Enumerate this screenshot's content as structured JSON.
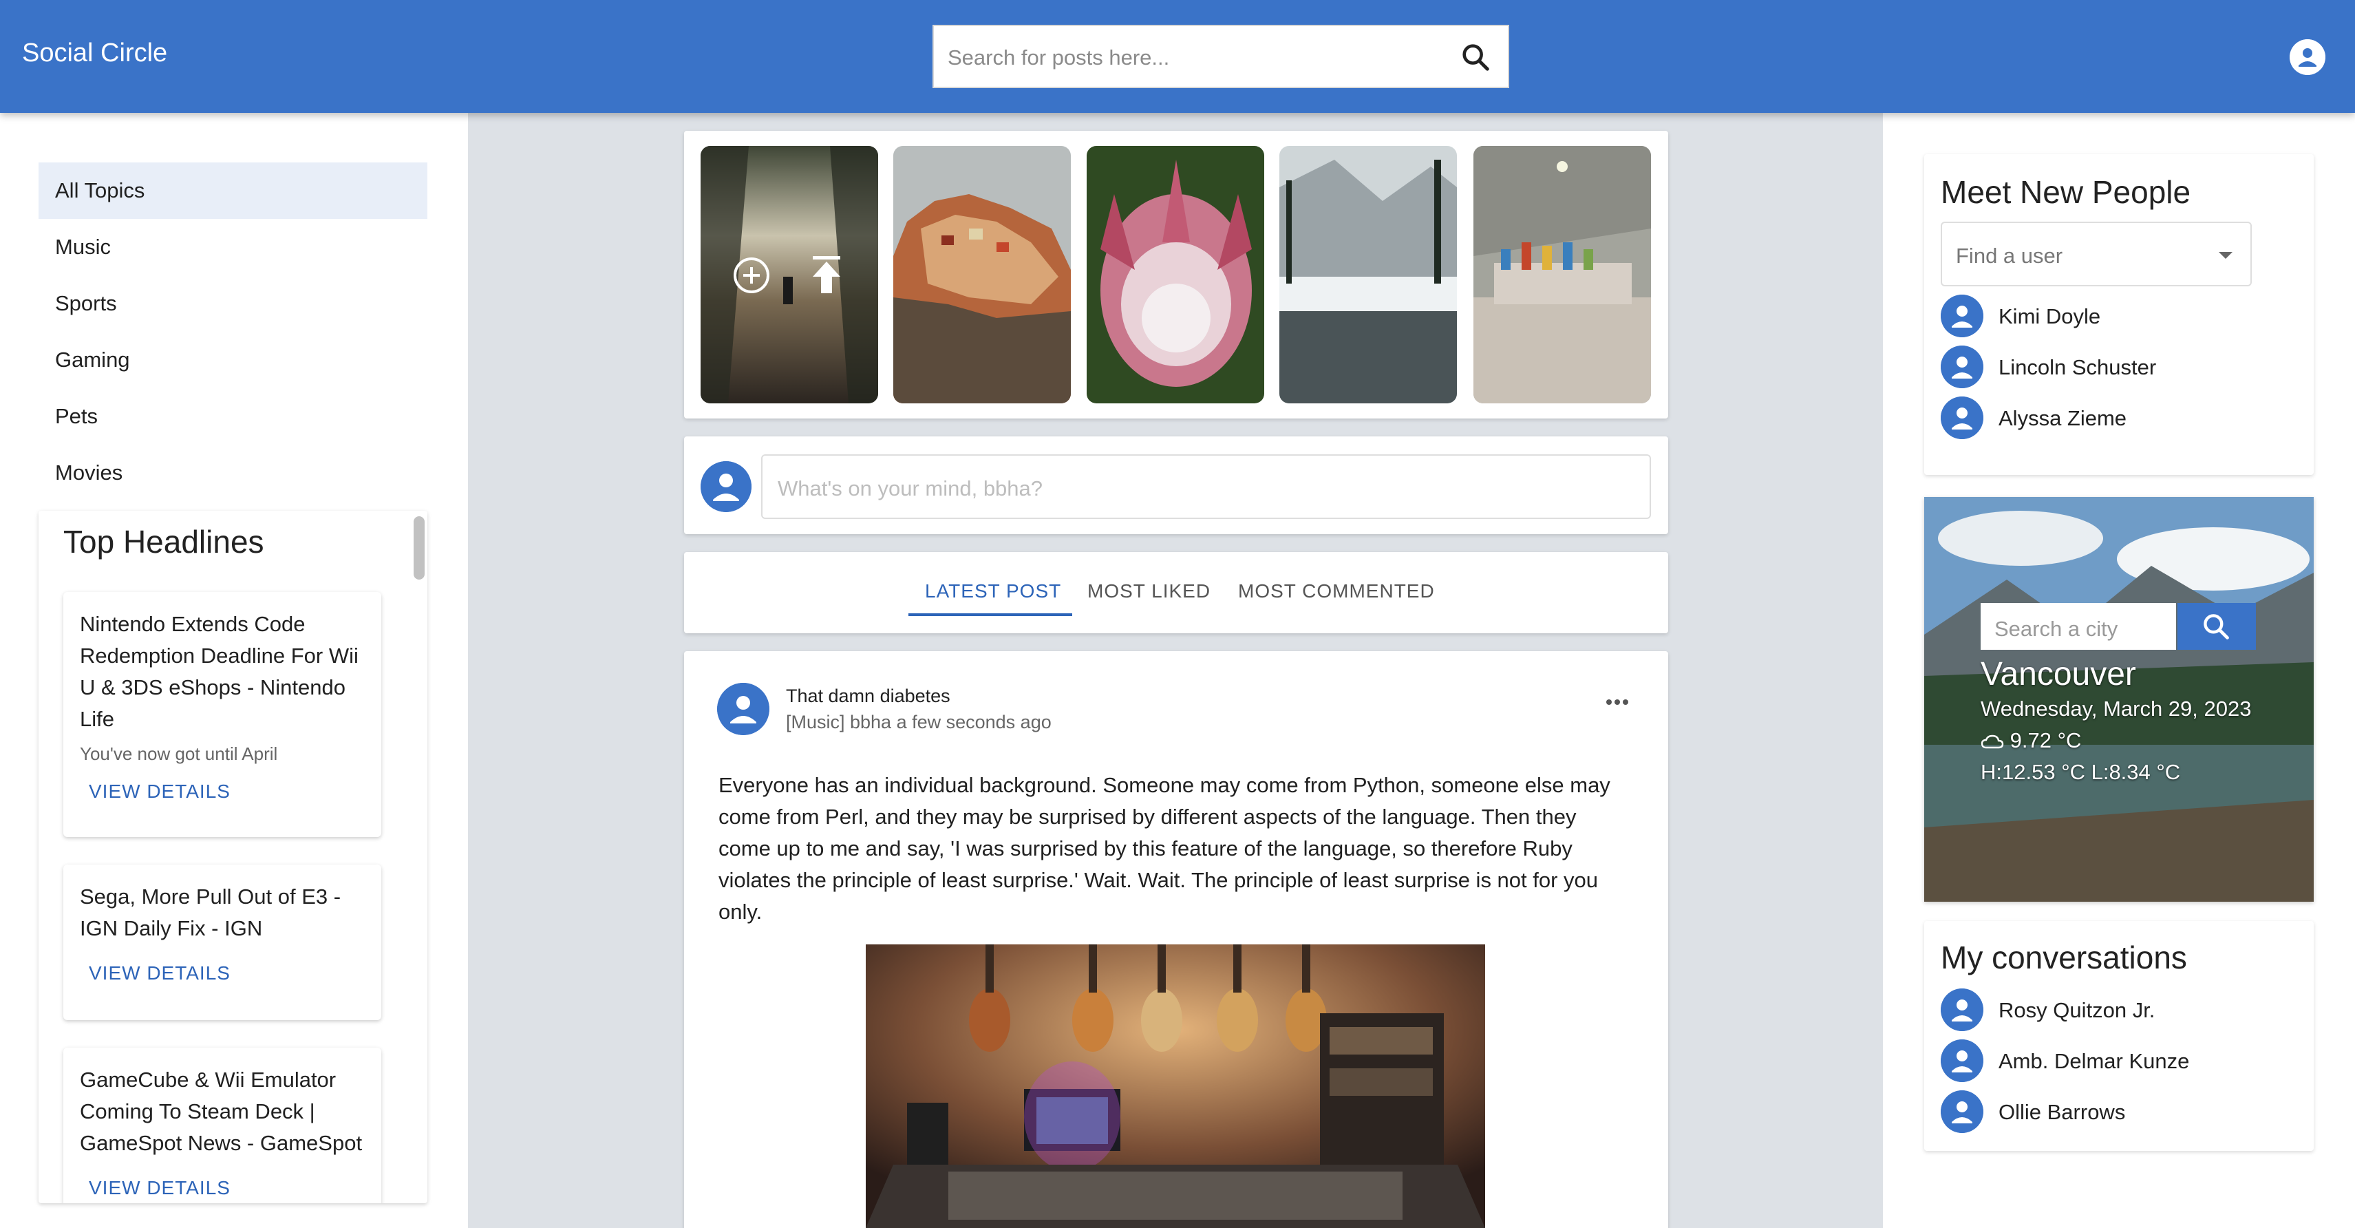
{
  "header": {
    "brand": "Social Circle",
    "search_placeholder": "Search for posts here..."
  },
  "topics": [
    "All Topics",
    "Music",
    "Sports",
    "Gaming",
    "Pets",
    "Movies"
  ],
  "headlines": {
    "title": "Top Headlines",
    "items": [
      {
        "title": "Nintendo Extends Code Redemption Deadline For Wii U & 3DS eShops - Nintendo Life",
        "description": "You've now got until April",
        "link": "VIEW DETAILS"
      },
      {
        "title": "Sega, More Pull Out of E3 - IGN Daily Fix - IGN",
        "description": "",
        "link": "VIEW DETAILS"
      },
      {
        "title": "GameCube & Wii Emulator Coming To Steam Deck | GameSpot News - GameSpot",
        "description": "",
        "link": "VIEW DETAILS"
      }
    ]
  },
  "composer": {
    "placeholder": "What's on your mind, bbha?"
  },
  "tabs": [
    "LATEST POST",
    "MOST LIKED",
    "MOST COMMENTED"
  ],
  "post": {
    "title": "That damn diabetes",
    "meta": "[Music] bbha a few seconds ago",
    "body": "Everyone has an individual background. Someone may come from Python, someone else may come from Perl, and they may be surprised by different aspects of the language. Then they come up to me and say, 'I was surprised by this feature of the language, so therefore Ruby violates the principle of least surprise.' Wait. Wait. The principle of least surprise is not for you only."
  },
  "meet": {
    "title": "Meet New People",
    "find_placeholder": "Find a user",
    "people": [
      "Kimi Doyle",
      "Lincoln Schuster",
      "Alyssa Zieme"
    ]
  },
  "weather": {
    "search_placeholder": "Search a city",
    "city": "Vancouver",
    "date": "Wednesday, March 29, 2023",
    "temp": "9.72 °C",
    "range": "H:12.53 °C L:8.34 °C"
  },
  "conversations": {
    "title": "My conversations",
    "people": [
      "Rosy Quitzon Jr.",
      "Amb. Delmar Kunze",
      "Ollie Barrows"
    ]
  },
  "icons": {
    "search": "search-icon",
    "avatar": "user-avatar-icon",
    "add": "add-circle-icon",
    "upload": "upload-icon",
    "more": "more-horizontal-icon",
    "cloud": "cloud-icon"
  },
  "colors": {
    "primary": "#3a73c8",
    "link": "#2d64b8",
    "background": "#dde1e6"
  }
}
